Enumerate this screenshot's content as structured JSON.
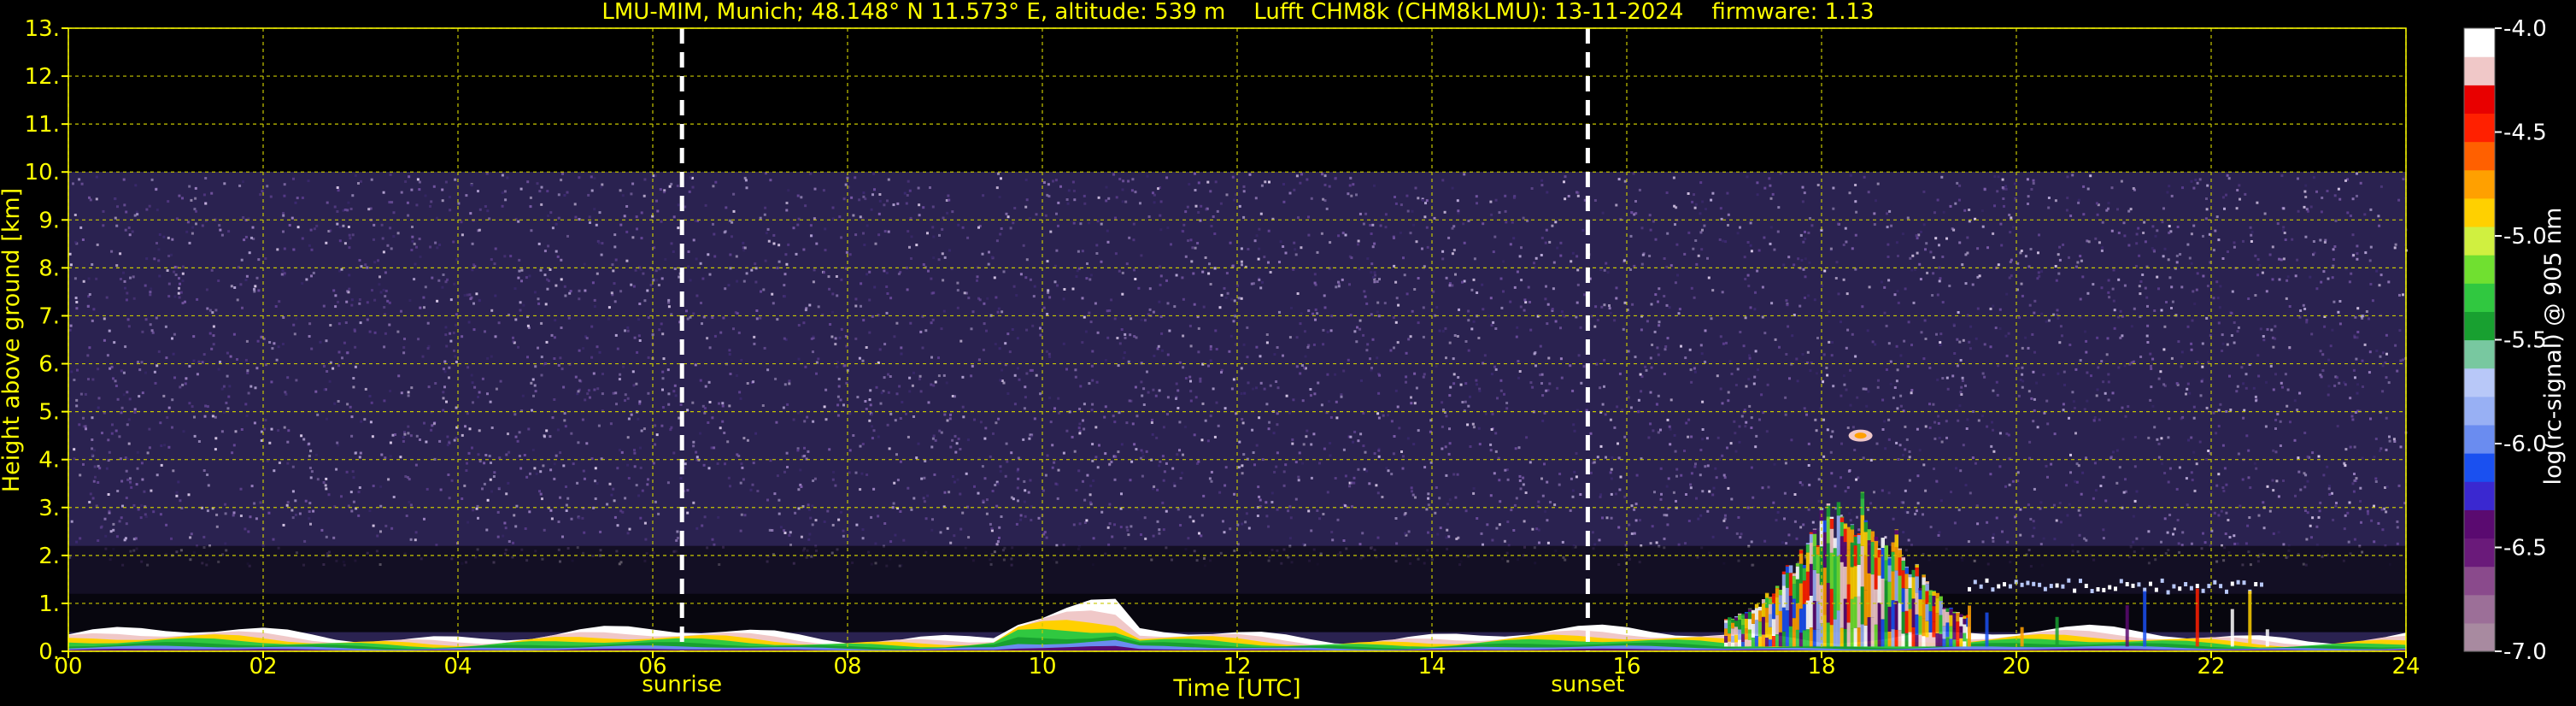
{
  "chart_data": {
    "type": "heatmap",
    "title": "LMU-MIM, Munich; 48.148° N 11.573° E, altitude: 539 m    Lufft CHM8k (CHM8kLMU): 13-11-2024    firmware: 1.13",
    "xlabel": "Time [UTC]",
    "ylabel": "Height above ground [km]",
    "xlim": [
      0,
      24
    ],
    "ylim": [
      0,
      13
    ],
    "x_ticks": [
      "00",
      "02",
      "04",
      "06",
      "08",
      "10",
      "12",
      "14",
      "16",
      "18",
      "20",
      "22",
      "24"
    ],
    "y_ticks": [
      "0.",
      "1.",
      "2.",
      "3.",
      "4.",
      "5.",
      "6.",
      "7.",
      "8.",
      "9.",
      "10.",
      "11.",
      "12.",
      "13."
    ],
    "grid": true,
    "colorbar": {
      "label": "log(rc-signal) @ 905 nm",
      "range": [
        -7.0,
        -4.0
      ],
      "ticks": [
        "-4.0",
        "-4.5",
        "-5.0",
        "-5.5",
        "-6.0",
        "-6.5",
        "-7.0"
      ],
      "colors": [
        "#a88aa0",
        "#9c6f98",
        "#8a4a8c",
        "#6a1a7a",
        "#5a0a70",
        "#3a28d0",
        "#1a50f0",
        "#6a8cf0",
        "#98b0f4",
        "#b8c8f8",
        "#78c8a0",
        "#18a030",
        "#30c840",
        "#70e030",
        "#d0f040",
        "#ffd000",
        "#ffa000",
        "#ff6000",
        "#ff2000",
        "#e80000",
        "#f0c8c8",
        "#ffffff"
      ]
    },
    "annotations": [
      {
        "label": "sunrise",
        "time": 6.3
      },
      {
        "label": "sunset",
        "time": 15.6
      }
    ],
    "features": {
      "noise_top_km": 10.0,
      "boundary_layer_top_km": 0.35,
      "cloud_time_range": [
        17.0,
        19.5
      ],
      "cloud_top_km": 3.6,
      "aloft_layer": {
        "time": 18.4,
        "height_km": 4.5
      },
      "thin_layer": {
        "time_range": [
          19.5,
          22.5
        ],
        "height_km": 1.4
      }
    }
  }
}
